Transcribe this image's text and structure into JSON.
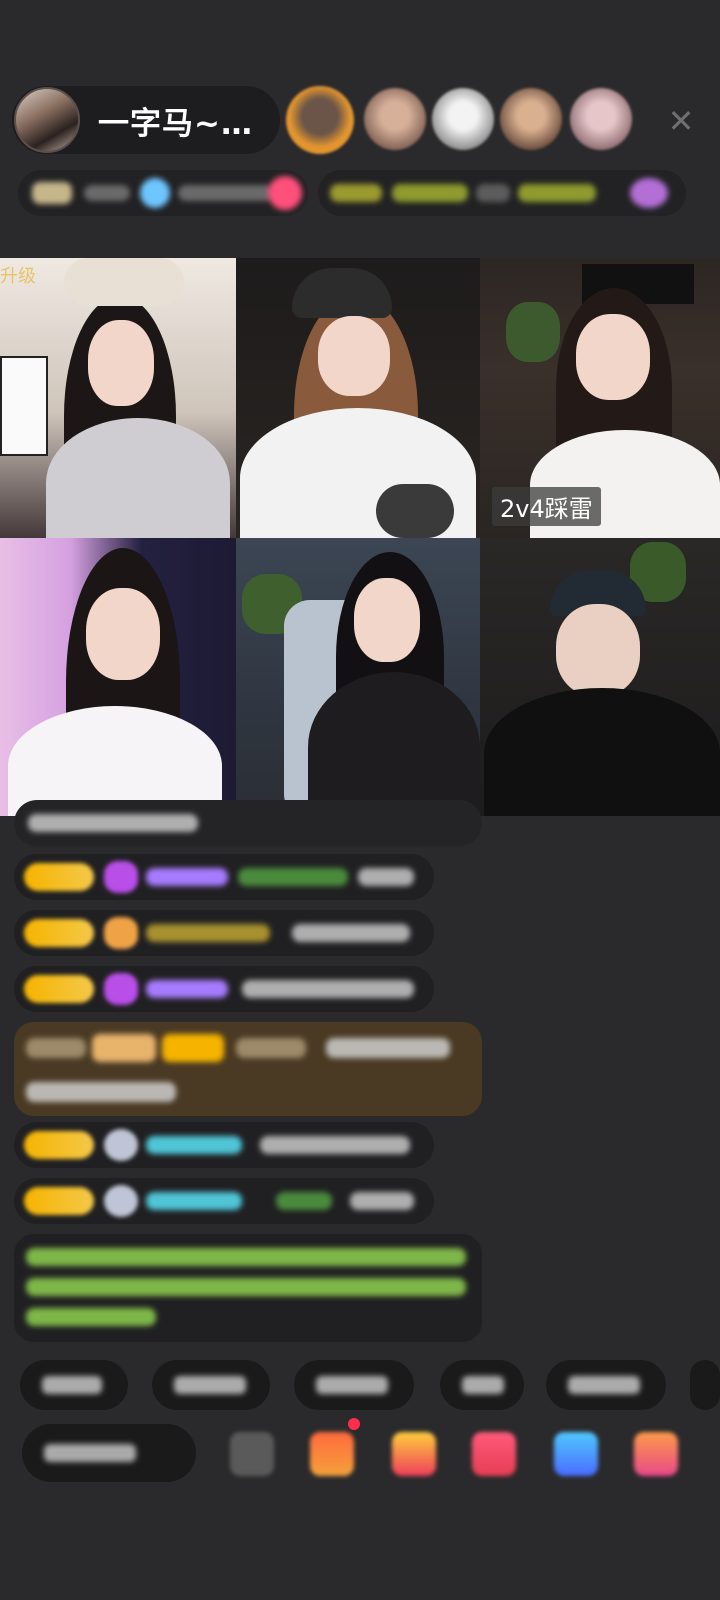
{
  "header": {
    "host_name": "一字马~…",
    "close_icon": "close-icon"
  },
  "viewers": [
    {
      "name": "viewer-1",
      "color": "#e3952f"
    },
    {
      "name": "viewer-2",
      "color": "#b98a72"
    },
    {
      "name": "viewer-3",
      "color": "#d8d8d8"
    },
    {
      "name": "viewer-4",
      "color": "#c99a78"
    },
    {
      "name": "viewer-5",
      "color": "#d7b4b8"
    }
  ],
  "video_grid": {
    "cells": [
      {
        "name": "guest-1",
        "corner_label": "升级"
      },
      {
        "name": "guest-2"
      },
      {
        "name": "guest-3",
        "badge": "2v4踩雷"
      },
      {
        "name": "guest-4"
      },
      {
        "name": "guest-5"
      },
      {
        "name": "guest-6"
      }
    ]
  },
  "colors": {
    "background": "#2a2a2c",
    "level_badge": "#f6b400",
    "name_purple": "#a77bff",
    "name_teal": "#4fc5d6",
    "name_green": "#6fbf3a",
    "system_message_green": "#8fd14f",
    "gift_panel": "#4b3a22"
  }
}
